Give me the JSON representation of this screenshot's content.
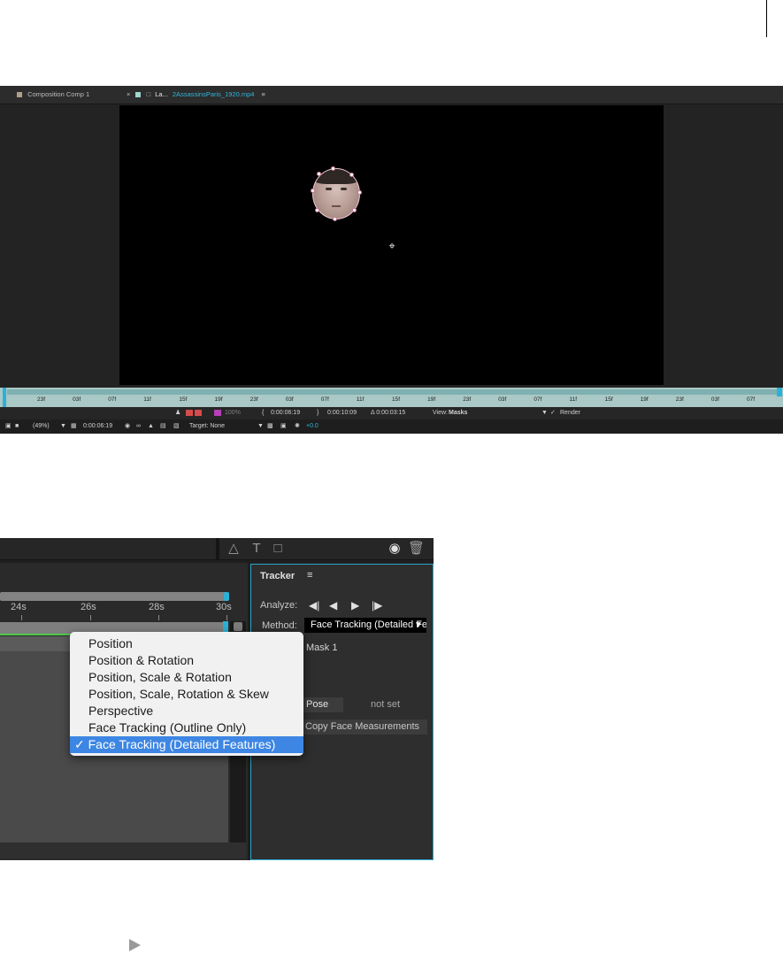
{
  "viewer": {
    "tabs": [
      {
        "label": "Composition Comp 1",
        "color": "#b0a08a"
      },
      {
        "close": "×",
        "label": "La...",
        "link_label": "2AssassinsParis_1920.mp4",
        "menu": "≡"
      }
    ],
    "timeline_ticks": [
      "23f",
      "03f",
      "07f",
      "11f",
      "15f",
      "19f",
      "23f",
      "03f",
      "07f",
      "11f",
      "15f",
      "19f",
      "23f",
      "03f",
      "07f",
      "11f",
      "15f",
      "19f",
      "23f",
      "03f",
      "07f"
    ],
    "status_row1": {
      "zoom_pct": "100%",
      "in_point": "0:00:06:19",
      "out_point": "0:00:10:09",
      "duration": "Δ 0:00:03:15",
      "view_label": "View:",
      "view_value": "Masks",
      "render_label": "Render"
    },
    "status_row2": {
      "magnification": "(49%)",
      "timecode": "0:00:06:19",
      "target_label": "Target: None",
      "exposure": "+0.0"
    }
  },
  "tracker": {
    "ruler_labels": [
      "24s",
      "26s",
      "28s",
      "30s"
    ],
    "panel_title": "Tracker",
    "panel_menu": "≡",
    "analyze_label": "Analyze:",
    "analyze_buttons": [
      "◀|",
      "◀",
      "▶",
      "|▶"
    ],
    "method_label": "Method:",
    "method_value": "Face Tracking (Detailed Features)",
    "mask_text": "Mask 1",
    "pose_button": "Pose",
    "pose_value": "not set",
    "copy_button": "Copy Face Measurements",
    "dropdown_items": [
      "Position",
      "Position & Rotation",
      "Position, Scale & Rotation",
      "Position, Scale, Rotation & Skew",
      "Perspective",
      "Face Tracking (Outline Only)",
      "Face Tracking (Detailed Features)"
    ],
    "selected_check": "✓",
    "accent_color": "#2aa8c8",
    "selection_color": "#3d86e3"
  }
}
